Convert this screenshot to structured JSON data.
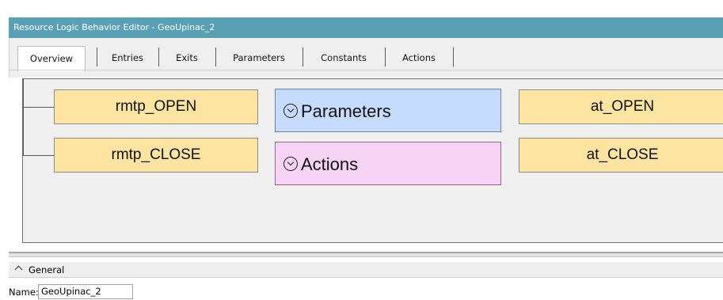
{
  "window": {
    "title": "Resource Logic Behavior Editor - GeoUpinac_2"
  },
  "tabs": [
    {
      "label": "Overview",
      "active": true
    },
    {
      "label": "Entries"
    },
    {
      "label": "Exits"
    },
    {
      "label": "Parameters"
    },
    {
      "label": "Constants"
    },
    {
      "label": "Actions"
    }
  ],
  "overview": {
    "entries": [
      "rmtp_OPEN",
      "rmtp_CLOSE"
    ],
    "parameters_label": "Parameters",
    "actions_label": "Actions",
    "exits": [
      "at_OPEN",
      "at_CLOSE"
    ],
    "colors": {
      "entry": "#fde4a0",
      "parameters": "#c5dcff",
      "actions": "#f7d3f5",
      "title_bar": "#5aa0b4"
    }
  },
  "general": {
    "header": "General",
    "name_label": "Name:",
    "name_value": "GeoUpinac_2"
  }
}
